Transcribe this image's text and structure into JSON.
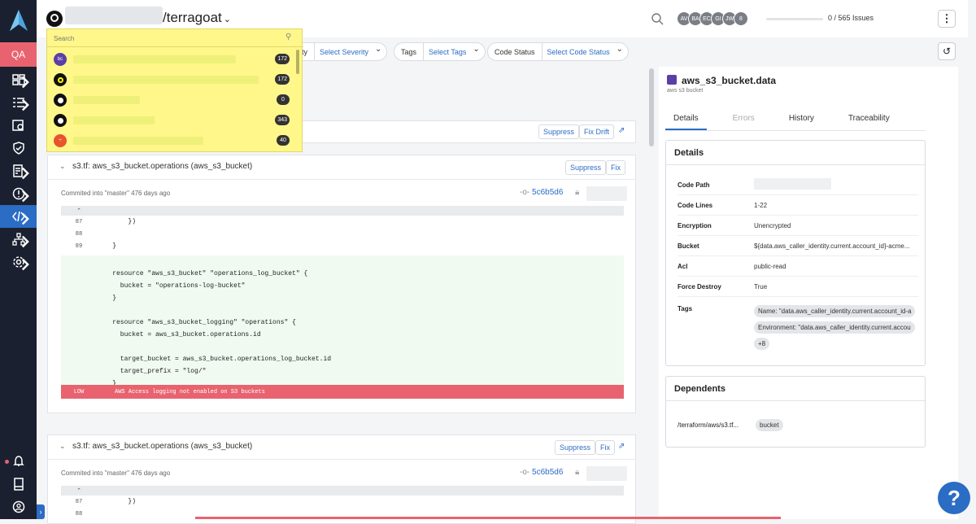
{
  "sidebar": {
    "env_label": "QA"
  },
  "header": {
    "repo_name": "/terragoat",
    "avatars": [
      "AV",
      "BA",
      "EC",
      "GI",
      "JW",
      "8"
    ],
    "issues_text": "0 / 565 Issues"
  },
  "filters": [
    {
      "label": "ity",
      "select": "Select Severity"
    },
    {
      "label": "Tags",
      "select": "Select Tags"
    },
    {
      "label": "Code Status",
      "select": "Select Code Status"
    }
  ],
  "dropdown": {
    "search_placeholder": "Search",
    "items": [
      {
        "icon": "bc",
        "count": "172"
      },
      {
        "icon": "circle",
        "count": "172"
      },
      {
        "icon": "github",
        "count": "0"
      },
      {
        "icon": "github",
        "count": "343"
      },
      {
        "icon": "git",
        "count": "40"
      }
    ]
  },
  "card0": {
    "suppress": "Suppress",
    "fix_drift": "Fix Drift"
  },
  "card1": {
    "title": "s3.tf: aws_s3_bucket.operations (aws_s3_bucket)",
    "suppress": "Suppress",
    "fix": "Fix",
    "commit": "Commited into \"master\" 476 days ago",
    "hash": "5c6b5d6",
    "lines": [
      {
        "n": "87",
        "t": "        })"
      },
      {
        "n": "88",
        "t": ""
      },
      {
        "n": "89",
        "t": "    }"
      }
    ],
    "added": [
      "",
      "    resource \"aws_s3_bucket\" \"operations_log_bucket\" {",
      "      bucket = \"operations-log-bucket\"",
      "    }",
      "",
      "    resource \"aws_s3_bucket_logging\" \"operations\" {",
      "      bucket = aws_s3_bucket.operations.id",
      "",
      "      target_bucket = aws_s3_bucket.operations_log_bucket.id",
      "      target_prefix = \"log/\"",
      "    }",
      ""
    ],
    "alert_sev": "LOW",
    "alert_text": "AWS Access logging not enabled on S3 buckets"
  },
  "card2": {
    "title": "s3.tf: aws_s3_bucket.operations (aws_s3_bucket)",
    "suppress": "Suppress",
    "fix": "Fix",
    "commit": "Commited into \"master\" 476 days ago",
    "hash": "5c6b5d6",
    "lines": [
      {
        "n": "87",
        "t": "        })"
      },
      {
        "n": "88",
        "t": ""
      }
    ]
  },
  "panel": {
    "title": "aws_s3_bucket.data",
    "subtitle": "aws s3 bucket",
    "tabs": [
      "Details",
      "Errors",
      "History",
      "Traceability"
    ],
    "details_header": "Details",
    "details": [
      {
        "k": "Code Path",
        "v": ""
      },
      {
        "k": "Code Lines",
        "v": "1-22"
      },
      {
        "k": "Encryption",
        "v": "Unencrypted"
      },
      {
        "k": "Bucket",
        "v": "${data.aws_caller_identity.current.account_id}-acme..."
      },
      {
        "k": "Acl",
        "v": "public-read"
      },
      {
        "k": "Force Destroy",
        "v": "True"
      }
    ],
    "tags_label": "Tags",
    "tags": [
      "Name: \"data.aws_caller_identity.current.account_id-a",
      "Environment: \"data.aws_caller_identity.current.accou",
      "+8"
    ],
    "dependents_header": "Dependents",
    "dependent_path": "/terraform/aws/s3.tf...",
    "dependent_tag": "bucket"
  },
  "help": "?"
}
